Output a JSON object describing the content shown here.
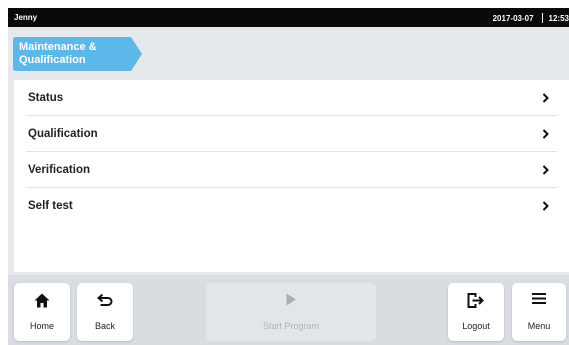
{
  "status_bar": {
    "user": "Jenny",
    "date": "2017-03-07",
    "time": "12:53"
  },
  "breadcrumb": {
    "line1": "Maintenance &",
    "line2": "Qualification",
    "color": "#5bb8e8"
  },
  "menu": {
    "items": [
      {
        "label": "Status"
      },
      {
        "label": "Qualification"
      },
      {
        "label": "Verification"
      },
      {
        "label": "Self test"
      }
    ]
  },
  "bottom_bar": {
    "home": {
      "label": "Home",
      "icon": "home-icon"
    },
    "back": {
      "label": "Back",
      "icon": "back-arrow-icon"
    },
    "start_program": {
      "label": "Start Program",
      "icon": "play-icon",
      "enabled": false
    },
    "logout": {
      "label": "Logout",
      "icon": "logout-icon"
    },
    "menu": {
      "label": "Menu",
      "icon": "hamburger-menu-icon"
    }
  }
}
